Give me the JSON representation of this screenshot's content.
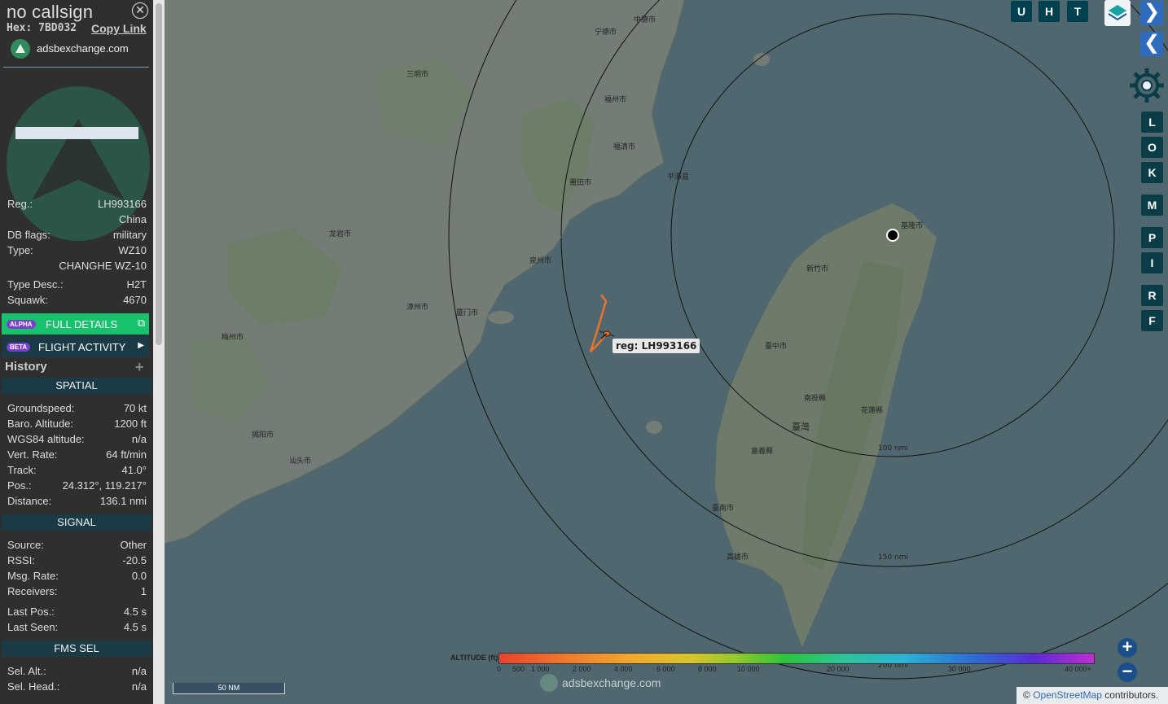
{
  "aircraft": {
    "callsign": "no callsign",
    "hex_label": "Hex:",
    "hex": "7BD032",
    "copy_link": "Copy Link",
    "site": "adsbexchange.com"
  },
  "details": [
    {
      "key": "Reg.:",
      "value": "LH993166"
    },
    {
      "key": "",
      "value": "China"
    },
    {
      "key": "DB flags:",
      "value": "military"
    },
    {
      "key": "Type:",
      "value": "WZ10"
    },
    {
      "key": "",
      "value": "CHANGHE WZ-10"
    },
    {
      "key": "Type Desc.:",
      "value": "H2T"
    },
    {
      "key": "Squawk:",
      "value": "4670"
    }
  ],
  "buttons": {
    "full_details": {
      "badge": "ALPHA",
      "label": "FULL DETAILS"
    },
    "flight_activity": {
      "badge": "BETA",
      "label": "FLIGHT ACTIVITY"
    }
  },
  "history_label": "History",
  "spatial": {
    "header": "SPATIAL",
    "rows": [
      {
        "key": "Groundspeed:",
        "value": "70 kt"
      },
      {
        "key": "Baro. Altitude:",
        "value": "1200 ft"
      },
      {
        "key": "WGS84 altitude:",
        "value": "n/a"
      },
      {
        "key": "Vert. Rate:",
        "value": "64 ft/min"
      },
      {
        "key": "Track:",
        "value": "41.0°"
      },
      {
        "key": "Pos.:",
        "value": "24.312°, 119.217°"
      },
      {
        "key": "Distance:",
        "value": "136.1 nmi"
      }
    ]
  },
  "signal": {
    "header": "SIGNAL",
    "rows": [
      {
        "key": "Source:",
        "value": "Other"
      },
      {
        "key": "RSSI:",
        "value": "-20.5"
      },
      {
        "key": "Msg. Rate:",
        "value": "0.0"
      },
      {
        "key": "Receivers:",
        "value": "1"
      },
      {
        "key": "Last Pos.:",
        "value": "4.5 s"
      },
      {
        "key": "Last Seen:",
        "value": "4.5 s"
      }
    ]
  },
  "fms": {
    "header": "FMS SEL",
    "rows": [
      {
        "key": "Sel. Alt.:",
        "value": "n/a"
      },
      {
        "key": "Sel. Head.:",
        "value": "n/a"
      }
    ]
  },
  "map": {
    "top_buttons": [
      "U",
      "H",
      "T"
    ],
    "side_buttons": [
      "L",
      "O",
      "K",
      "M",
      "P",
      "I",
      "R",
      "F"
    ],
    "aircraft_label": "reg: LH993166",
    "range_labels": [
      "100 nmi",
      "150 nmi",
      "200 nmi"
    ],
    "scale_label": "50 NM",
    "attribution_prefix": "© ",
    "attribution_link": "OpenStreetMap",
    "attribution_suffix": " contributors.",
    "watermark": "adsbexchange.com",
    "place_labels": [
      "福州市",
      "莆田市",
      "泉州市",
      "厦门市",
      "漳州市",
      "龙岩市",
      "三明市",
      "梅州市",
      "揭阳市",
      "汕头市",
      "新竹市",
      "臺灣",
      "臺南市",
      "高雄市",
      "臺中市",
      "基隆市",
      "花蓮縣",
      "南投縣",
      "嘉義縣",
      "宁德市",
      "中德市",
      "福清市",
      "平潭县"
    ]
  },
  "altitude_legend": {
    "title": "ALTITUDE (ft)",
    "ticks": [
      "0",
      "500",
      "1 000",
      "2 000",
      "4 000",
      "6 000",
      "8 000",
      "10 000",
      "20 000",
      "30 000",
      "40 000+"
    ]
  },
  "colors": {
    "accent_green": "#18c26c",
    "section_header": "#1a3b45",
    "flight_track": "#e8732c",
    "button_blue": "#2f6bbf",
    "sidebar_button": "#0a3d48"
  }
}
